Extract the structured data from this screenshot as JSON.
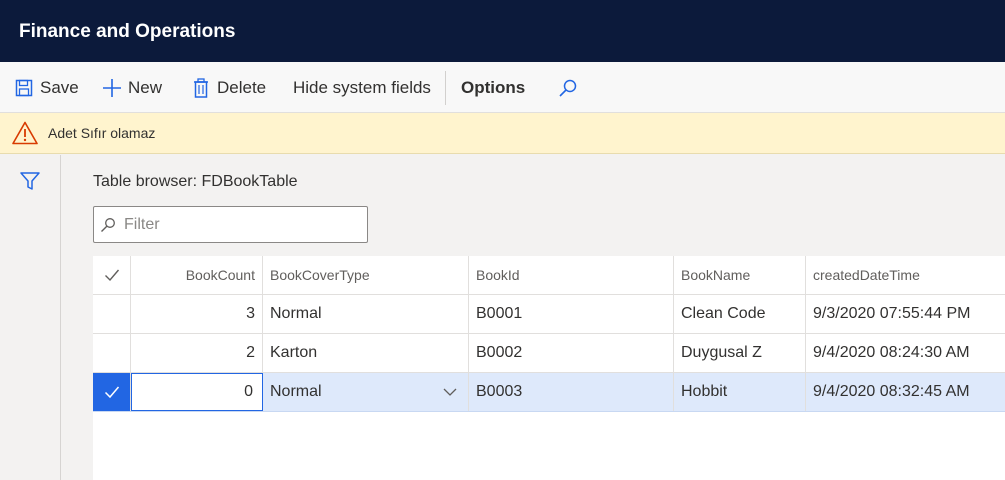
{
  "app": {
    "title": "Finance and Operations"
  },
  "toolbar": {
    "save_label": "Save",
    "new_label": "New",
    "delete_label": "Delete",
    "hide_system_fields_label": "Hide system fields",
    "options_label": "Options",
    "icons": {
      "save": "save-icon",
      "new": "plus-icon",
      "delete": "trash-icon",
      "search": "search-icon"
    }
  },
  "warning": {
    "message": "Adet Sıfır olamaz",
    "icon": "warning-icon",
    "background": "#fff4ce"
  },
  "page": {
    "title": "Table browser: FDBookTable"
  },
  "filter": {
    "placeholder": "Filter",
    "value": ""
  },
  "grid": {
    "columns": [
      "BookCount",
      "BookCoverType",
      "BookId",
      "BookName",
      "createdDateTime"
    ],
    "rows": [
      {
        "BookCount": "3",
        "BookCoverType": "Normal",
        "BookId": "B0001",
        "BookName": "Clean Code",
        "createdDateTime": "9/3/2020 07:55:44 PM",
        "selected": false
      },
      {
        "BookCount": "2",
        "BookCoverType": "Karton",
        "BookId": "B0002",
        "BookName": "Duygusal Z",
        "createdDateTime": "9/4/2020 08:24:30 AM",
        "selected": false
      },
      {
        "BookCount": "0",
        "BookCoverType": "Normal",
        "BookId": "B0003",
        "BookName": "Hobbit",
        "createdDateTime": "9/4/2020 08:32:45 AM",
        "selected": true
      }
    ]
  },
  "colors": {
    "header_bg": "#0c1a3b",
    "accent": "#2266e3",
    "selected_row": "#dee9fb"
  }
}
